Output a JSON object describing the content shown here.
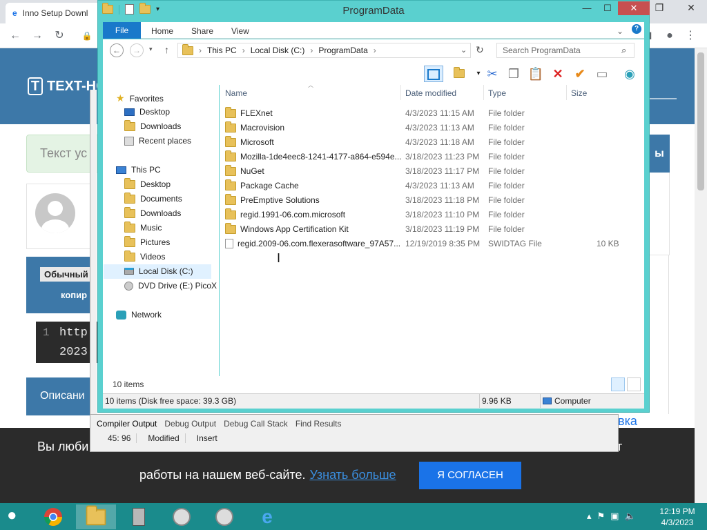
{
  "browser": {
    "tab_title": "Inno Setup Downl",
    "window_controls": [
      "—",
      "❐",
      "✕"
    ]
  },
  "website": {
    "logo_text": "TEXT-HOST",
    "green_text": "Текст ус",
    "profile_fragment": "",
    "badge": "Обычный",
    "copy_label": "копир",
    "code": {
      "line_number": "1",
      "line1": "http",
      "line2": "2023"
    },
    "section_title": "Описани",
    "right_tab": "ы",
    "right_link": "вка",
    "cookie": {
      "line1": "Вы люби",
      "line1_end": "т",
      "line2_text": "работы на нашем веб-сайте.",
      "learn_more": "Узнать больше",
      "agree": "Я СОГЛАСЕН"
    }
  },
  "inno": {
    "tabs": [
      "Compiler Output",
      "Debug Output",
      "Debug Call Stack",
      "Find Results"
    ],
    "status": [
      "45:  96",
      "Modified",
      "Insert"
    ]
  },
  "explorer": {
    "title": "ProgramData",
    "window_controls": [
      "—",
      "☐",
      "✕"
    ],
    "ribbon_tabs": [
      "File",
      "Home",
      "Share",
      "View"
    ],
    "address": {
      "parts": [
        "This PC",
        "Local Disk (C:)",
        "ProgramData"
      ],
      "separator": "›"
    },
    "search_placeholder": "Search ProgramData",
    "nav": {
      "favorites_label": "Favorites",
      "favorites": [
        "Desktop",
        "Downloads",
        "Recent places"
      ],
      "thispc_label": "This PC",
      "thispc": [
        "Desktop",
        "Documents",
        "Downloads",
        "Music",
        "Pictures",
        "Videos",
        "Local Disk (C:)",
        "DVD Drive (E:) PicoX"
      ],
      "network_label": "Network"
    },
    "columns": {
      "name": "Name",
      "date": "Date modified",
      "type": "Type",
      "size": "Size"
    },
    "files": [
      {
        "name": "FLEXnet",
        "date": "4/3/2023 11:15 AM",
        "type": "File folder",
        "size": "",
        "kind": "folder"
      },
      {
        "name": "Macrovision",
        "date": "4/3/2023 11:13 AM",
        "type": "File folder",
        "size": "",
        "kind": "folder"
      },
      {
        "name": "Microsoft",
        "date": "4/3/2023 11:18 AM",
        "type": "File folder",
        "size": "",
        "kind": "folder"
      },
      {
        "name": "Mozilla-1de4eec8-1241-4177-a864-e594e...",
        "date": "3/18/2023 11:23 PM",
        "type": "File folder",
        "size": "",
        "kind": "folder"
      },
      {
        "name": "NuGet",
        "date": "3/18/2023 11:17 PM",
        "type": "File folder",
        "size": "",
        "kind": "folder"
      },
      {
        "name": "Package Cache",
        "date": "4/3/2023 11:13 AM",
        "type": "File folder",
        "size": "",
        "kind": "folder"
      },
      {
        "name": "PreEmptive Solutions",
        "date": "3/18/2023 11:18 PM",
        "type": "File folder",
        "size": "",
        "kind": "folder"
      },
      {
        "name": "regid.1991-06.com.microsoft",
        "date": "3/18/2023 11:10 PM",
        "type": "File folder",
        "size": "",
        "kind": "folder"
      },
      {
        "name": "Windows App Certification Kit",
        "date": "3/18/2023 11:19 PM",
        "type": "File folder",
        "size": "",
        "kind": "folder"
      },
      {
        "name": "regid.2009-06.com.flexerasoftware_97A57...",
        "date": "12/19/2019 8:35 PM",
        "type": "SWIDTAG File",
        "size": "10 KB",
        "kind": "file"
      }
    ],
    "item_count": "10 items",
    "status_left": "10 items (Disk free space: 39.3 GB)",
    "status_size": "9.96 KB",
    "status_location": "Computer"
  },
  "taskbar": {
    "clock_time": "12:19 PM",
    "clock_date": "4/3/2023"
  },
  "colors": {
    "explorer_frame": "#5ad0cf",
    "taskbar": "#1a8b8c",
    "site_blue": "#3d78a8",
    "accent_button": "#1a73e8"
  }
}
